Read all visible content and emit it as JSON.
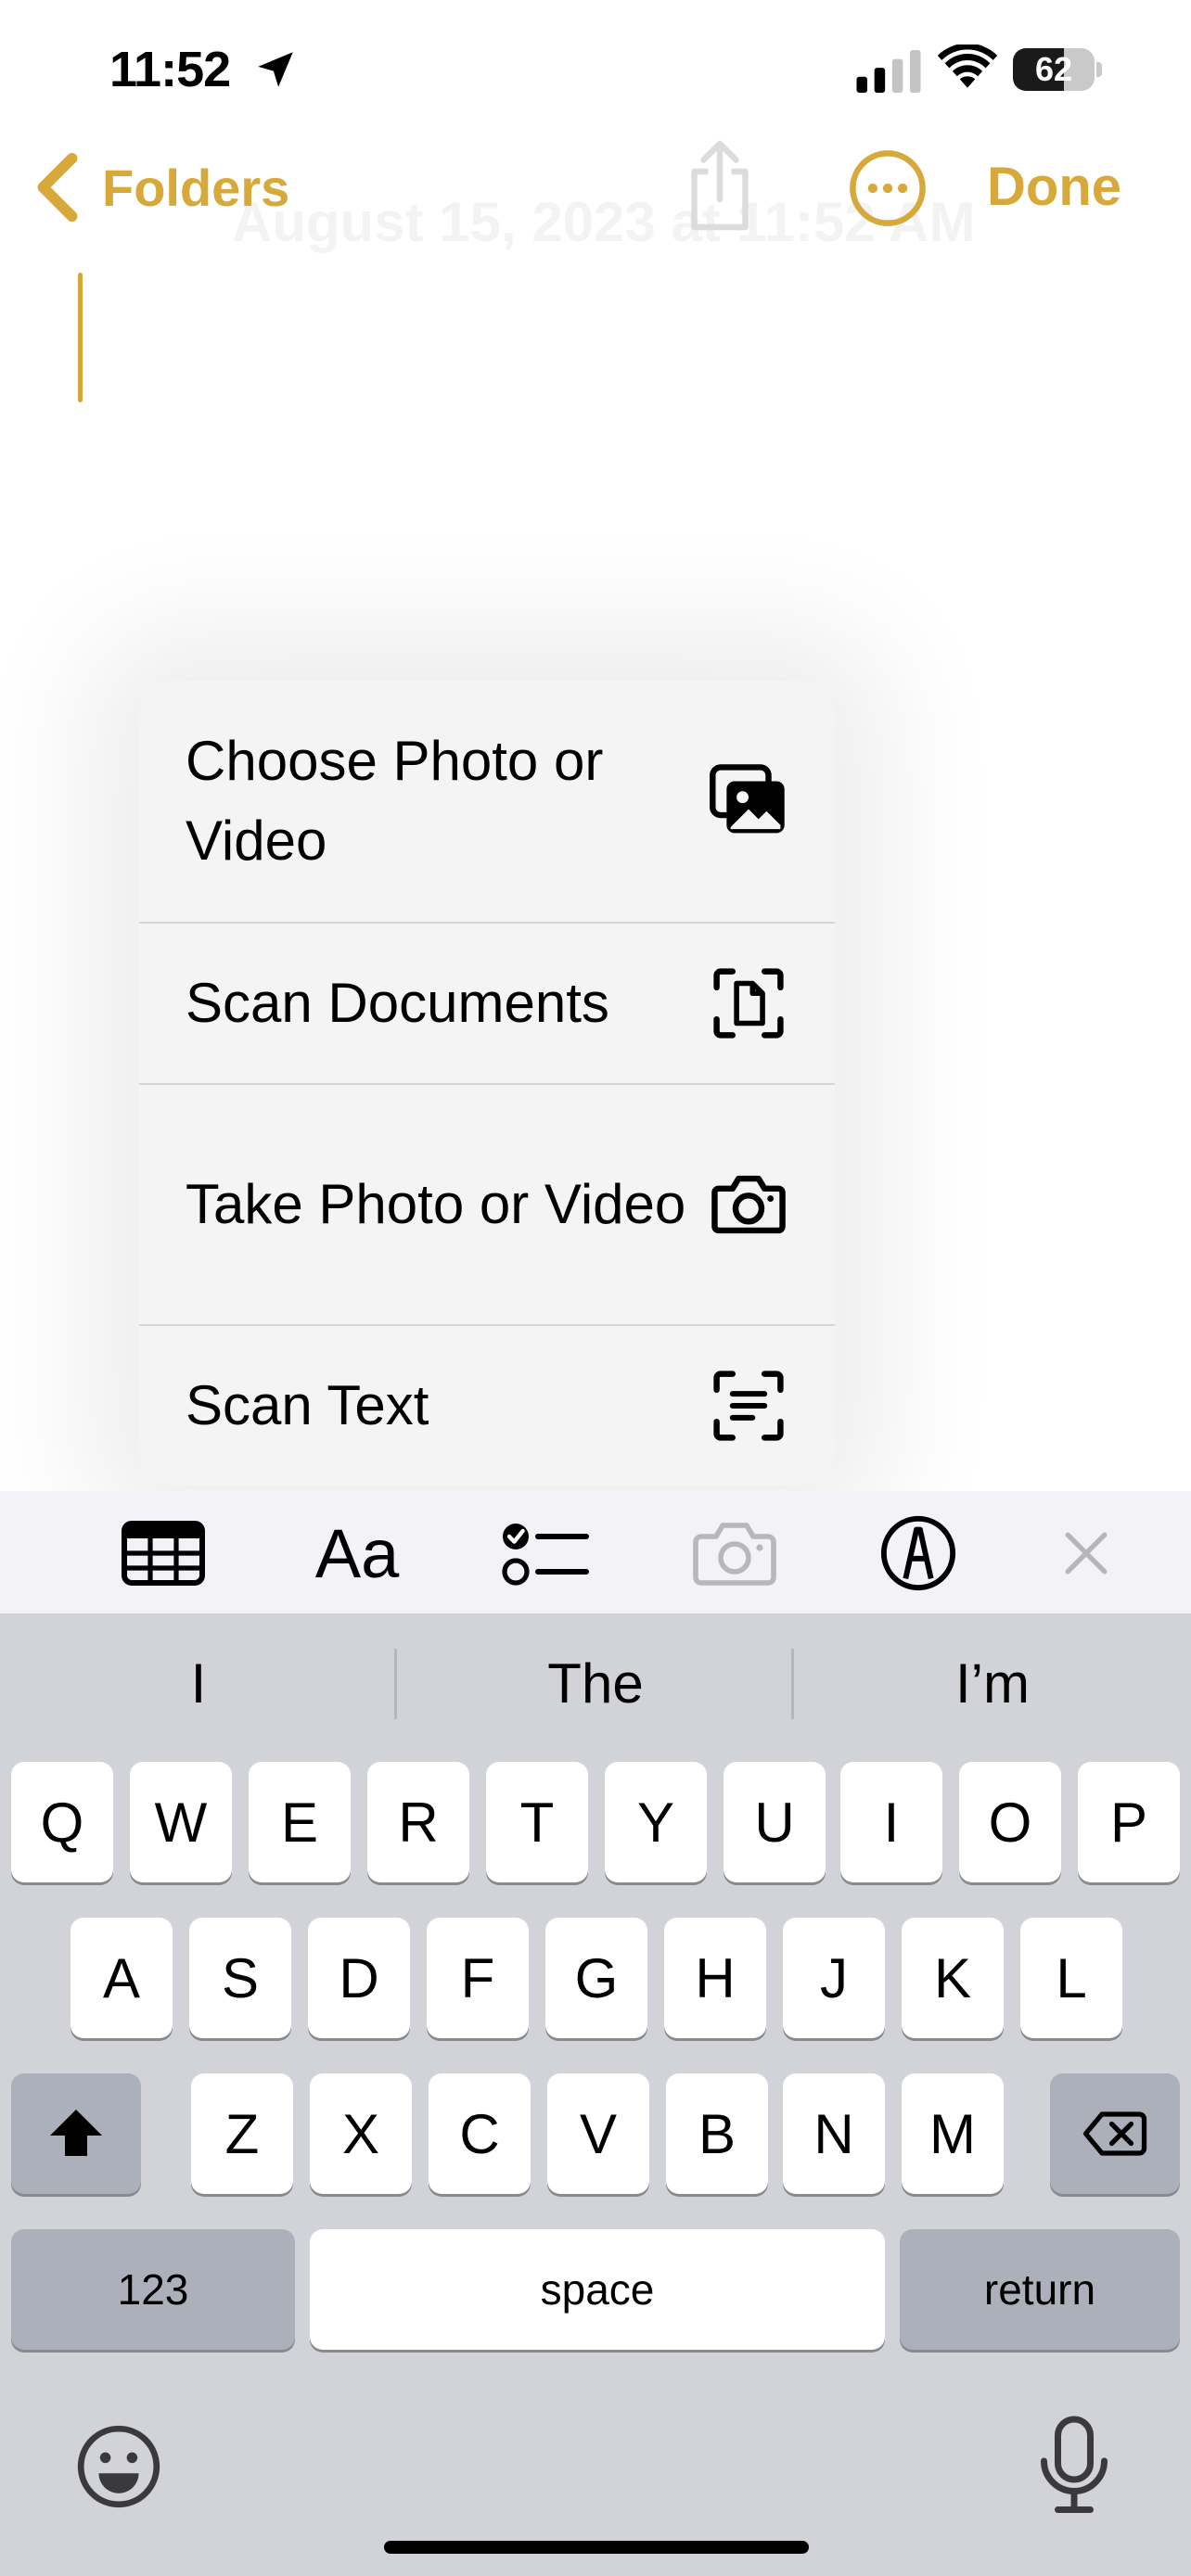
{
  "status_bar": {
    "time": "11:52",
    "battery": "62",
    "battery_level": 0.62
  },
  "nav": {
    "back_label": "Folders",
    "done_label": "Done",
    "date_header": "August 15, 2023 at 11:52 AM"
  },
  "menu": {
    "items": [
      {
        "label": "Choose Photo or Video",
        "icon": "photo-library-icon"
      },
      {
        "label": "Scan Documents",
        "icon": "document-scan-icon"
      },
      {
        "label": "Take Photo or Video",
        "icon": "camera-icon"
      },
      {
        "label": "Scan Text",
        "icon": "text-scan-icon"
      }
    ]
  },
  "toolbar": {
    "format_label": "Aa",
    "items": [
      "table-icon",
      "format-text-icon",
      "checklist-icon",
      "camera-icon",
      "markup-icon",
      "close-icon"
    ]
  },
  "keyboard": {
    "suggestions": [
      "I",
      "The",
      "I’m"
    ],
    "row1": [
      "Q",
      "W",
      "E",
      "R",
      "T",
      "Y",
      "U",
      "I",
      "O",
      "P"
    ],
    "row2": [
      "A",
      "S",
      "D",
      "F",
      "G",
      "H",
      "J",
      "K",
      "L"
    ],
    "row3": [
      "Z",
      "X",
      "C",
      "V",
      "B",
      "N",
      "M"
    ],
    "numbers_label": "123",
    "space_label": "space",
    "return_label": "return"
  },
  "colors": {
    "accent": "#d6a93a",
    "keyboard_bg": "#d1d3d9",
    "key_dark": "#abb0ba"
  }
}
